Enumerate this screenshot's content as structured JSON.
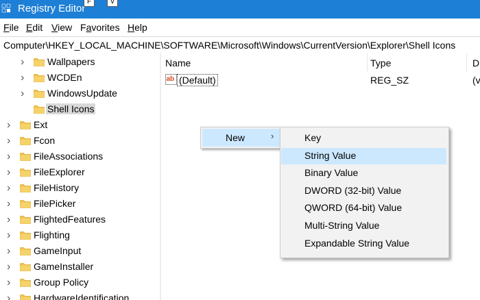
{
  "window": {
    "title": "Registry Editor",
    "keytips": [
      "F",
      "V"
    ]
  },
  "menubar": {
    "items": [
      {
        "pre": "",
        "mnemonic": "F",
        "post": "ile"
      },
      {
        "pre": "",
        "mnemonic": "E",
        "post": "dit"
      },
      {
        "pre": "",
        "mnemonic": "V",
        "post": "iew"
      },
      {
        "pre": "F",
        "mnemonic": "a",
        "post": "vorites"
      },
      {
        "pre": "",
        "mnemonic": "H",
        "post": "elp"
      }
    ]
  },
  "address": {
    "path": "Computer\\HKEY_LOCAL_MACHINE\\SOFTWARE\\Microsoft\\Windows\\CurrentVersion\\Explorer\\Shell Icons"
  },
  "tree": {
    "items": [
      {
        "label": "Wallpapers",
        "expandable": true,
        "depth": 1
      },
      {
        "label": "WCDEn",
        "expandable": true,
        "depth": 1
      },
      {
        "label": "WindowsUpdate",
        "expandable": true,
        "depth": 1
      },
      {
        "label": "Shell Icons",
        "expandable": false,
        "depth": 1,
        "selected": true
      },
      {
        "label": "Ext",
        "expandable": true,
        "depth": 0
      },
      {
        "label": "Fcon",
        "expandable": true,
        "depth": 0
      },
      {
        "label": "FileAssociations",
        "expandable": true,
        "depth": 0
      },
      {
        "label": "FileExplorer",
        "expandable": true,
        "depth": 0
      },
      {
        "label": "FileHistory",
        "expandable": true,
        "depth": 0
      },
      {
        "label": "FilePicker",
        "expandable": true,
        "depth": 0
      },
      {
        "label": "FlightedFeatures",
        "expandable": true,
        "depth": 0
      },
      {
        "label": "Flighting",
        "expandable": true,
        "depth": 0
      },
      {
        "label": "GameInput",
        "expandable": true,
        "depth": 0
      },
      {
        "label": "GameInstaller",
        "expandable": true,
        "depth": 0
      },
      {
        "label": "Group Policy",
        "expandable": true,
        "depth": 0
      },
      {
        "label": "HardwareIdentification",
        "expandable": true,
        "depth": 0
      }
    ]
  },
  "list": {
    "columns": [
      "Name",
      "Type",
      "D"
    ],
    "rows": [
      {
        "name": "(Default)",
        "type": "REG_SZ",
        "data": "(v",
        "icon": "string-value-icon"
      }
    ]
  },
  "context_menu": {
    "item": "New",
    "submenu": [
      "Key",
      "String Value",
      "Binary Value",
      "DWORD (32-bit) Value",
      "QWORD (64-bit) Value",
      "Multi-String Value",
      "Expandable String Value"
    ],
    "highlighted": "String Value"
  },
  "icons": {
    "folder": "folder-icon",
    "expand": "chevron-right-icon",
    "submenu": "chevron-right-icon",
    "app": "registry-editor-icon"
  },
  "colors": {
    "titlebar": "#1e7fd6",
    "folder": "#f1c34e",
    "highlight": "#cce8ff",
    "selected_node": "#d9d9d9",
    "string_icon": "#d44a1f"
  }
}
